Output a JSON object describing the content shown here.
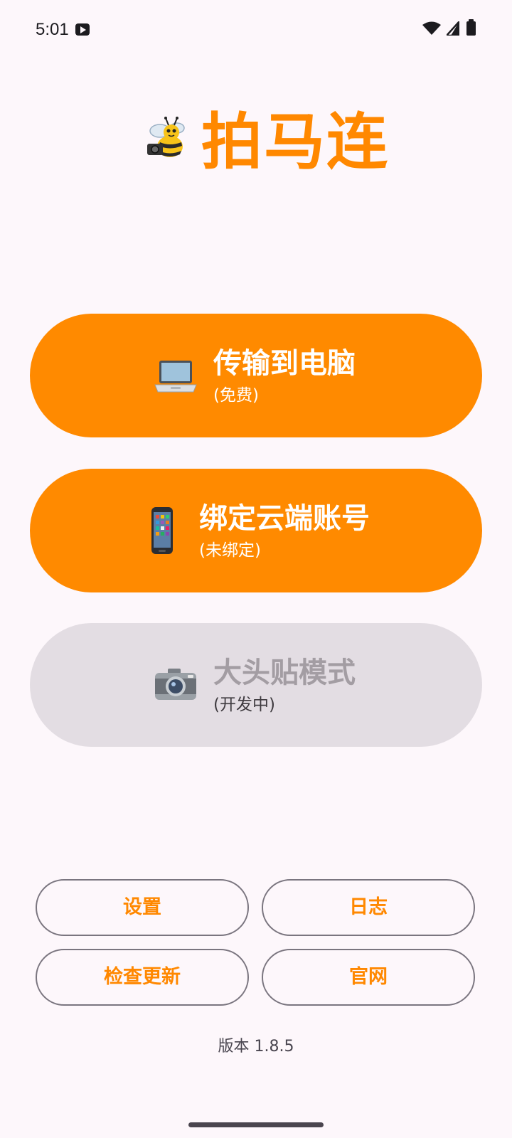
{
  "status_bar": {
    "time": "5:01",
    "icons": [
      "app-notification-icon",
      "wifi-icon",
      "signal-icon",
      "battery-icon"
    ]
  },
  "header": {
    "logo_icon": "bee-icon",
    "title": "拍马连"
  },
  "main_buttons": [
    {
      "icon": "laptop-icon",
      "label": "传输到电脑",
      "sub": "(免费)",
      "enabled": true
    },
    {
      "icon": "mobile-phone-icon",
      "label": "绑定云端账号",
      "sub": "(未绑定)",
      "enabled": true
    },
    {
      "icon": "camera-icon",
      "label": "大头贴模式",
      "sub": "(开发中)",
      "enabled": false
    }
  ],
  "secondary_buttons": {
    "settings": "设置",
    "logs": "日志",
    "check_update": "检查更新",
    "website": "官网"
  },
  "version_text": "版本 1.8.5",
  "colors": {
    "accent": "#ff8a00",
    "background": "#fdf7fb",
    "disabled": "#e3dde3",
    "outline": "#7a757f"
  }
}
